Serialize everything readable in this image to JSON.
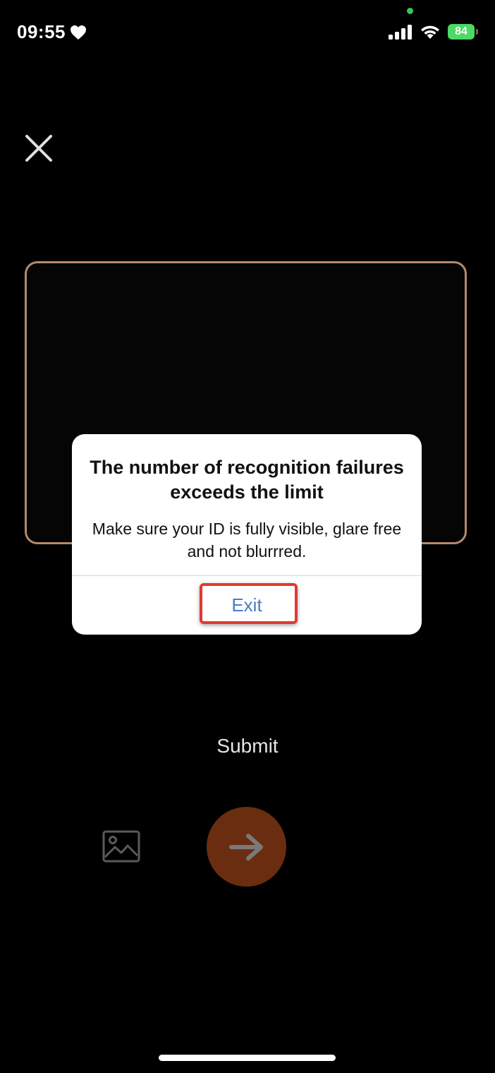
{
  "status_bar": {
    "time": "09:55",
    "battery_level": "84",
    "icons": [
      "heart-icon",
      "signal-icon",
      "wifi-icon",
      "battery-icon"
    ]
  },
  "header": {
    "close_icon": "close-icon"
  },
  "dialog": {
    "title": "The number of recognition failures exceeds the limit",
    "message": "Make sure your ID is fully visible, glare free and not blurrred.",
    "exit_label": "Exit"
  },
  "controls": {
    "submit_label": "Submit",
    "gallery_icon": "image-gallery-icon",
    "next_icon": "arrow-right-icon"
  },
  "colors": {
    "background": "#000000",
    "frame_border": "#b58a6a",
    "exit_text": "#4a7cc6",
    "highlight": "#e03a32",
    "next_button": "#6b2d0f",
    "battery": "#4cd964"
  }
}
